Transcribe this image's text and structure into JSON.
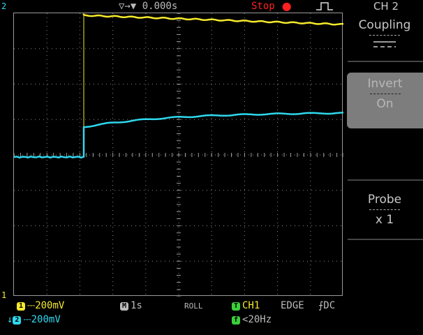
{
  "top": {
    "channel_marker": "2",
    "trigger_position": "▽→▼ 0.000s",
    "run_state": "Stop",
    "run_state_color": "#ff2020",
    "panel_title": "CH 2"
  },
  "side_menu": {
    "coupling_label": "Coupling",
    "invert_label": "Invert",
    "invert_value": "On",
    "probe_label": "Probe",
    "probe_value": "x 1"
  },
  "bottom": {
    "ch1_marker": "1",
    "ch1_scale": "200mV",
    "ch2_marker": "2",
    "ch2_scale": "200mV",
    "timebase_badge": "M",
    "timebase": "1s",
    "mode": "ROLL",
    "trigger_badge": "T",
    "trigger_source": "CH1",
    "trigger_type": "EDGE",
    "trigger_coupling": "DC",
    "freq_badge": "f",
    "frequency": "<20Hz"
  },
  "colors": {
    "ch1": "#f5ea2c",
    "ch2": "#2fd8ee",
    "grid": "#8a8a8a",
    "panel_bg": "#000000",
    "menu_active_bg": "#7d7d7d",
    "trigger_green": "#3ccf3c"
  }
}
